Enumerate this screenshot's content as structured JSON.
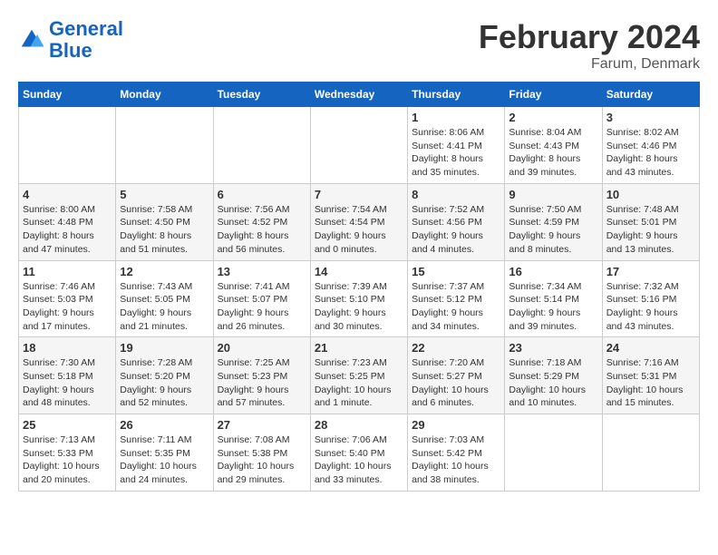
{
  "header": {
    "logo_line1": "General",
    "logo_line2": "Blue",
    "title": "February 2024",
    "subtitle": "Farum, Denmark"
  },
  "calendar": {
    "weekdays": [
      "Sunday",
      "Monday",
      "Tuesday",
      "Wednesday",
      "Thursday",
      "Friday",
      "Saturday"
    ],
    "weeks": [
      [
        {
          "day": "",
          "info": ""
        },
        {
          "day": "",
          "info": ""
        },
        {
          "day": "",
          "info": ""
        },
        {
          "day": "",
          "info": ""
        },
        {
          "day": "1",
          "info": "Sunrise: 8:06 AM\nSunset: 4:41 PM\nDaylight: 8 hours\nand 35 minutes."
        },
        {
          "day": "2",
          "info": "Sunrise: 8:04 AM\nSunset: 4:43 PM\nDaylight: 8 hours\nand 39 minutes."
        },
        {
          "day": "3",
          "info": "Sunrise: 8:02 AM\nSunset: 4:46 PM\nDaylight: 8 hours\nand 43 minutes."
        }
      ],
      [
        {
          "day": "4",
          "info": "Sunrise: 8:00 AM\nSunset: 4:48 PM\nDaylight: 8 hours\nand 47 minutes."
        },
        {
          "day": "5",
          "info": "Sunrise: 7:58 AM\nSunset: 4:50 PM\nDaylight: 8 hours\nand 51 minutes."
        },
        {
          "day": "6",
          "info": "Sunrise: 7:56 AM\nSunset: 4:52 PM\nDaylight: 8 hours\nand 56 minutes."
        },
        {
          "day": "7",
          "info": "Sunrise: 7:54 AM\nSunset: 4:54 PM\nDaylight: 9 hours\nand 0 minutes."
        },
        {
          "day": "8",
          "info": "Sunrise: 7:52 AM\nSunset: 4:56 PM\nDaylight: 9 hours\nand 4 minutes."
        },
        {
          "day": "9",
          "info": "Sunrise: 7:50 AM\nSunset: 4:59 PM\nDaylight: 9 hours\nand 8 minutes."
        },
        {
          "day": "10",
          "info": "Sunrise: 7:48 AM\nSunset: 5:01 PM\nDaylight: 9 hours\nand 13 minutes."
        }
      ],
      [
        {
          "day": "11",
          "info": "Sunrise: 7:46 AM\nSunset: 5:03 PM\nDaylight: 9 hours\nand 17 minutes."
        },
        {
          "day": "12",
          "info": "Sunrise: 7:43 AM\nSunset: 5:05 PM\nDaylight: 9 hours\nand 21 minutes."
        },
        {
          "day": "13",
          "info": "Sunrise: 7:41 AM\nSunset: 5:07 PM\nDaylight: 9 hours\nand 26 minutes."
        },
        {
          "day": "14",
          "info": "Sunrise: 7:39 AM\nSunset: 5:10 PM\nDaylight: 9 hours\nand 30 minutes."
        },
        {
          "day": "15",
          "info": "Sunrise: 7:37 AM\nSunset: 5:12 PM\nDaylight: 9 hours\nand 34 minutes."
        },
        {
          "day": "16",
          "info": "Sunrise: 7:34 AM\nSunset: 5:14 PM\nDaylight: 9 hours\nand 39 minutes."
        },
        {
          "day": "17",
          "info": "Sunrise: 7:32 AM\nSunset: 5:16 PM\nDaylight: 9 hours\nand 43 minutes."
        }
      ],
      [
        {
          "day": "18",
          "info": "Sunrise: 7:30 AM\nSunset: 5:18 PM\nDaylight: 9 hours\nand 48 minutes."
        },
        {
          "day": "19",
          "info": "Sunrise: 7:28 AM\nSunset: 5:20 PM\nDaylight: 9 hours\nand 52 minutes."
        },
        {
          "day": "20",
          "info": "Sunrise: 7:25 AM\nSunset: 5:23 PM\nDaylight: 9 hours\nand 57 minutes."
        },
        {
          "day": "21",
          "info": "Sunrise: 7:23 AM\nSunset: 5:25 PM\nDaylight: 10 hours\nand 1 minute."
        },
        {
          "day": "22",
          "info": "Sunrise: 7:20 AM\nSunset: 5:27 PM\nDaylight: 10 hours\nand 6 minutes."
        },
        {
          "day": "23",
          "info": "Sunrise: 7:18 AM\nSunset: 5:29 PM\nDaylight: 10 hours\nand 10 minutes."
        },
        {
          "day": "24",
          "info": "Sunrise: 7:16 AM\nSunset: 5:31 PM\nDaylight: 10 hours\nand 15 minutes."
        }
      ],
      [
        {
          "day": "25",
          "info": "Sunrise: 7:13 AM\nSunset: 5:33 PM\nDaylight: 10 hours\nand 20 minutes."
        },
        {
          "day": "26",
          "info": "Sunrise: 7:11 AM\nSunset: 5:35 PM\nDaylight: 10 hours\nand 24 minutes."
        },
        {
          "day": "27",
          "info": "Sunrise: 7:08 AM\nSunset: 5:38 PM\nDaylight: 10 hours\nand 29 minutes."
        },
        {
          "day": "28",
          "info": "Sunrise: 7:06 AM\nSunset: 5:40 PM\nDaylight: 10 hours\nand 33 minutes."
        },
        {
          "day": "29",
          "info": "Sunrise: 7:03 AM\nSunset: 5:42 PM\nDaylight: 10 hours\nand 38 minutes."
        },
        {
          "day": "",
          "info": ""
        },
        {
          "day": "",
          "info": ""
        }
      ]
    ]
  }
}
